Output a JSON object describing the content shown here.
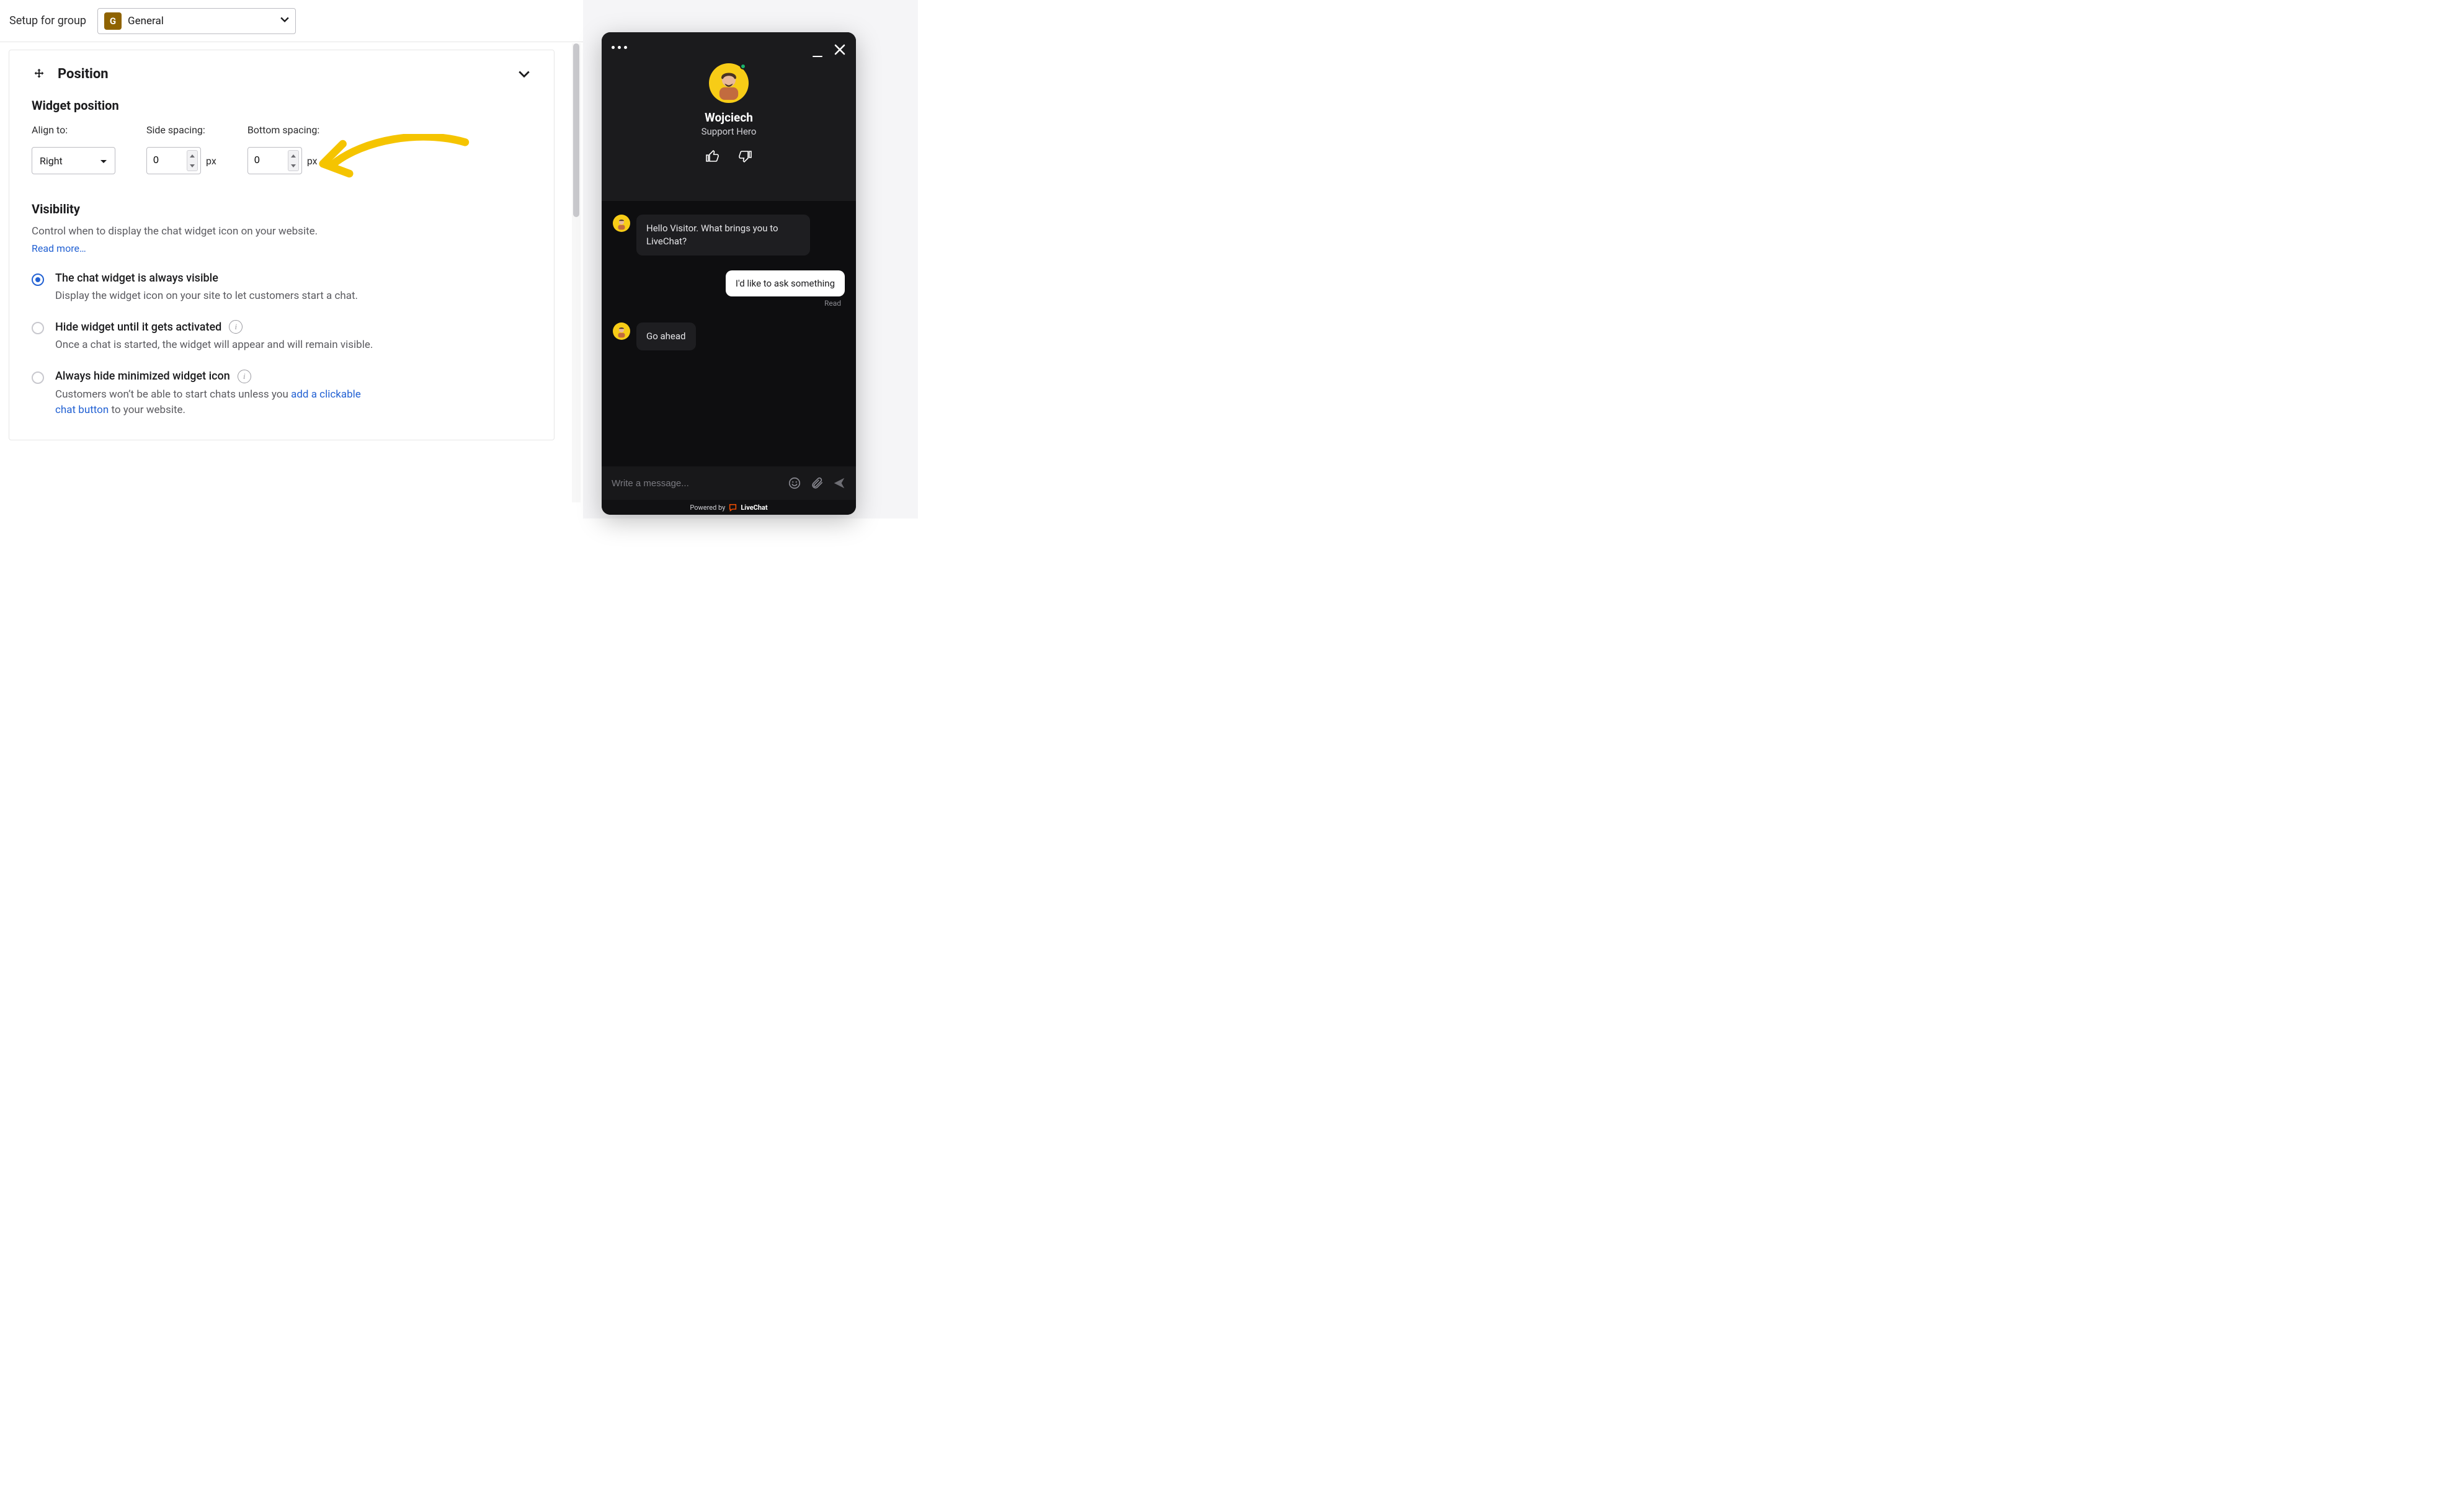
{
  "header": {
    "setupLabel": "Setup for group",
    "groupBadge": "G",
    "groupName": "General"
  },
  "position": {
    "sectionTitle": "Position",
    "widgetPositionHeading": "Widget position",
    "alignLabel": "Align to:",
    "alignValue": "Right",
    "sideSpacingLabel": "Side spacing:",
    "sideSpacingValue": "0",
    "sideSpacingUnit": "px",
    "bottomSpacingLabel": "Bottom spacing:",
    "bottomSpacingValue": "0",
    "bottomSpacingUnit": "px"
  },
  "visibility": {
    "heading": "Visibility",
    "description": "Control when to display the chat widget icon on your website.",
    "readMore": "Read more…",
    "options": {
      "always": {
        "title": "The chat widget is always visible",
        "desc": "Display the widget icon on your site to let customers start a chat."
      },
      "hideUntil": {
        "title": "Hide widget until it gets activated",
        "desc": "Once a chat is started, the widget will appear and will remain visible."
      },
      "alwaysHide": {
        "title": "Always hide minimized widget icon",
        "descPrefix": "Customers won’t be able to start chats unless you ",
        "descLink": "add a clickable chat button",
        "descSuffix": " to your website."
      }
    }
  },
  "chat": {
    "agentName": "Wojciech",
    "agentRole": "Support Hero",
    "messages": {
      "m1": "Hello Visitor. What brings you to LiveChat?",
      "m2": "I'd like to ask something",
      "m3": "Go ahead"
    },
    "readLabel": "Read",
    "inputPlaceholder": "Write a message...",
    "poweredPrefix": "Powered by",
    "poweredBrand": "LiveChat"
  }
}
